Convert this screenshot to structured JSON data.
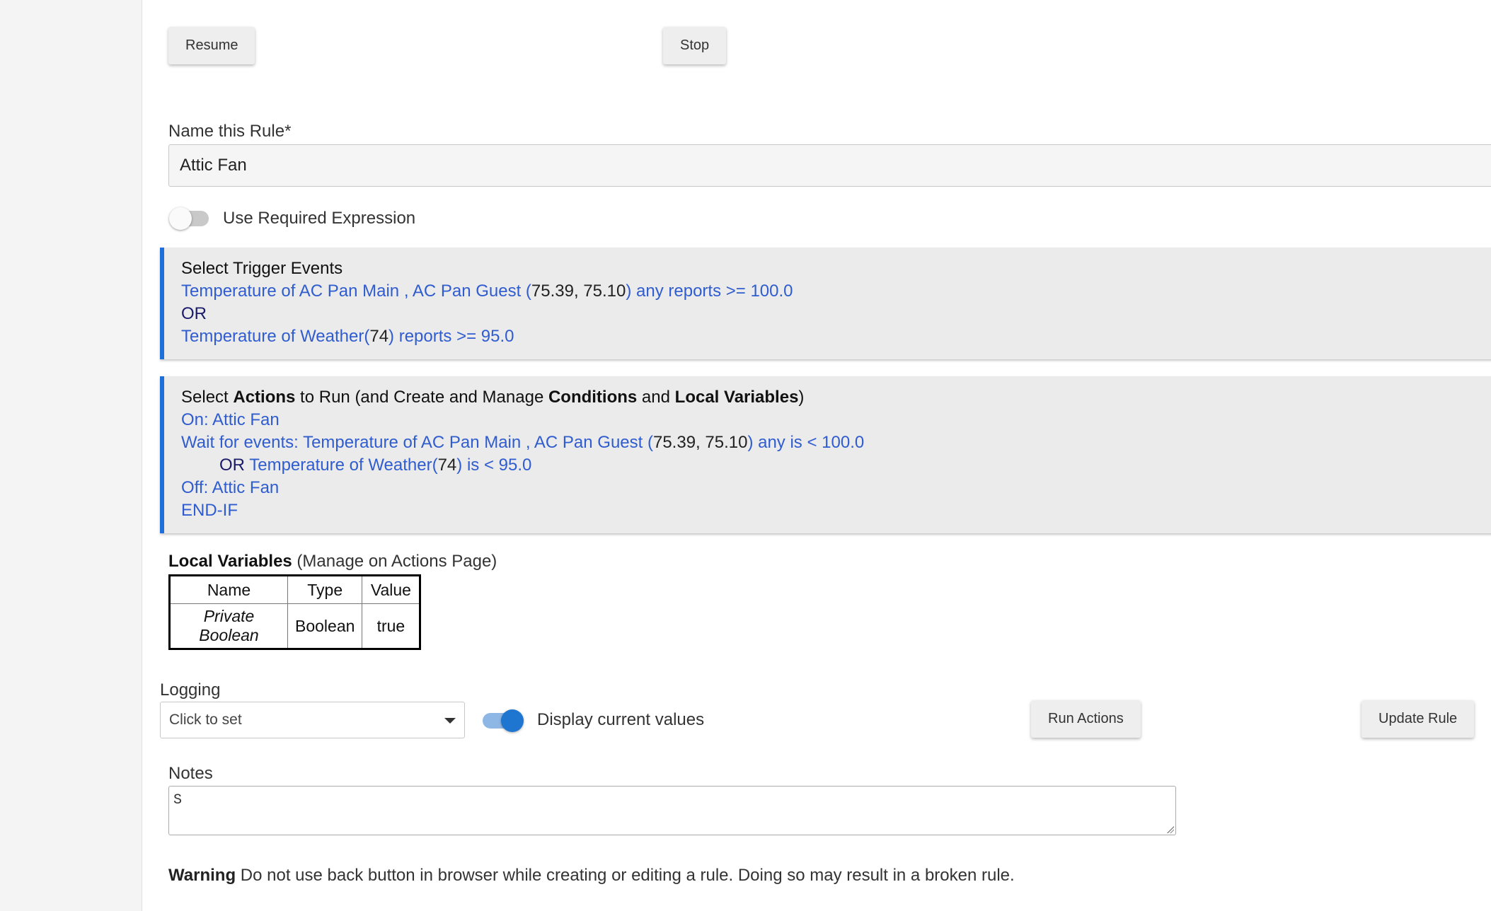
{
  "buttons": {
    "resume": "Resume",
    "stop": "Stop",
    "run_actions": "Run Actions",
    "update_rule": "Update Rule"
  },
  "rule_name": {
    "label": "Name this Rule*",
    "value": "Attic Fan"
  },
  "required_expression": {
    "label": "Use Required Expression",
    "enabled": false
  },
  "triggers": {
    "title": "Select Trigger Events",
    "line1": {
      "pre": "Temperature of AC Pan Main , AC Pan Guest (",
      "values": "75.39, 75.10",
      "post": ") any reports >= 100.0"
    },
    "or": "OR",
    "line2": {
      "pre": "Temperature of Weather(",
      "values": "74",
      "post": ") reports >= 95.0"
    }
  },
  "actions": {
    "title_parts": [
      "Select ",
      "Actions",
      " to Run (and Create and Manage ",
      "Conditions",
      " and ",
      "Local Variables",
      ")"
    ],
    "on": "On: Attic Fan",
    "wait": {
      "pre": "Wait for events: Temperature of AC Pan Main , AC Pan Guest (",
      "values": "75.39, 75.10",
      "post": ") any is < 100.0"
    },
    "wait_or": {
      "or": "OR",
      "pre": "Temperature of Weather(",
      "values": "74",
      "post": ") is < 95.0"
    },
    "off": "Off: Attic Fan",
    "endif": "END-IF"
  },
  "local_variables": {
    "title": "Local Variables",
    "subtitle": " (Manage on Actions Page)",
    "columns": [
      "Name",
      "Type",
      "Value"
    ],
    "rows": [
      [
        "Private Boolean",
        "Boolean",
        "true"
      ]
    ]
  },
  "logging": {
    "label": "Logging",
    "placeholder": "Click to set"
  },
  "display_values": {
    "label": "Display current values",
    "enabled": true
  },
  "notes": {
    "label": "Notes",
    "value": "S"
  },
  "warning": {
    "bold": "Warning",
    "text": " Do not use back button in browser while creating or editing a rule. Doing so may result in a broken rule."
  },
  "colors": {
    "accent": "#1e6fd9",
    "link": "#2f5ccf",
    "panel_bg": "#ebebeb",
    "toggle_on": "#1e76d0"
  }
}
